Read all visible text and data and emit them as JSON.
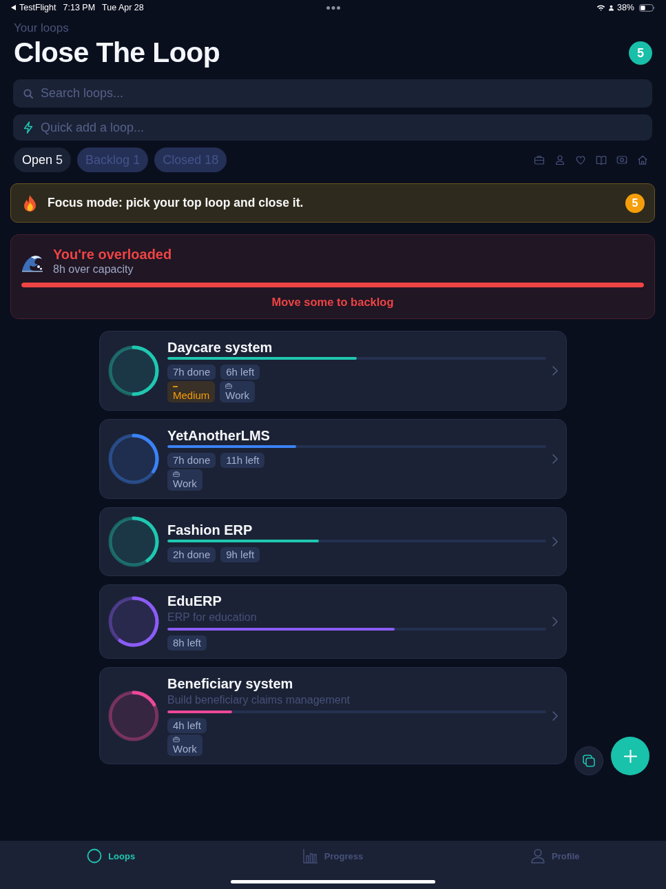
{
  "status_bar": {
    "back_label": "TestFlight",
    "time": "7:13 PM",
    "date": "Tue Apr 28",
    "battery": "38%"
  },
  "header": {
    "subtitle": "Your loops",
    "title": "Close The Loop",
    "count": "5"
  },
  "search": {
    "placeholder": "Search loops..."
  },
  "quick_add": {
    "placeholder": "Quick add a loop..."
  },
  "tabs": [
    {
      "label": "Open",
      "count": "5",
      "selected": true
    },
    {
      "label": "Backlog",
      "count": "1",
      "selected": false
    },
    {
      "label": "Closed",
      "count": "18",
      "selected": false
    }
  ],
  "focus_banner": {
    "text": "Focus mode: pick your top loop and close it.",
    "count": "5"
  },
  "overload_alert": {
    "title": "You're overloaded",
    "detail": "8h over capacity",
    "level": 1,
    "action": "Move some to backlog"
  },
  "loops": [
    {
      "name": "Daycare system",
      "color": "#1fc7b0",
      "progress": {
        "level": 0.5
      },
      "stats": [
        "7h done",
        "6h left"
      ],
      "tags": [
        {
          "kind": "priority",
          "text": "Medium"
        },
        {
          "kind": "category",
          "text": "Work"
        }
      ]
    },
    {
      "name": "YetAnotherLMS",
      "color": "#3b82f6",
      "progress": {
        "level": 0.34
      },
      "stats": [
        "7h done",
        "11h left"
      ],
      "tags": [
        {
          "kind": "category",
          "text": "Work"
        }
      ]
    },
    {
      "name": "Fashion ERP",
      "color": "#1fc7b0",
      "progress": {
        "level": 0.4
      },
      "stats": [
        "2h done",
        "9h left"
      ]
    },
    {
      "name": "EduERP",
      "description": "ERP for education",
      "color": "#8b5cf6",
      "progress": {
        "level": 0.6
      },
      "stats": [
        "8h left"
      ]
    },
    {
      "name": "Beneficiary system",
      "description": "Build beneficiary claims management",
      "color": "#ec4899",
      "progress": {
        "level": 0.17
      },
      "stats": [
        "4h left"
      ],
      "tags": [
        {
          "kind": "category",
          "text": "Work"
        }
      ]
    }
  ],
  "bottom_nav": [
    {
      "label": "Loops",
      "selected": true
    },
    {
      "label": "Progress",
      "selected": false
    },
    {
      "label": "Profile",
      "selected": false
    }
  ]
}
